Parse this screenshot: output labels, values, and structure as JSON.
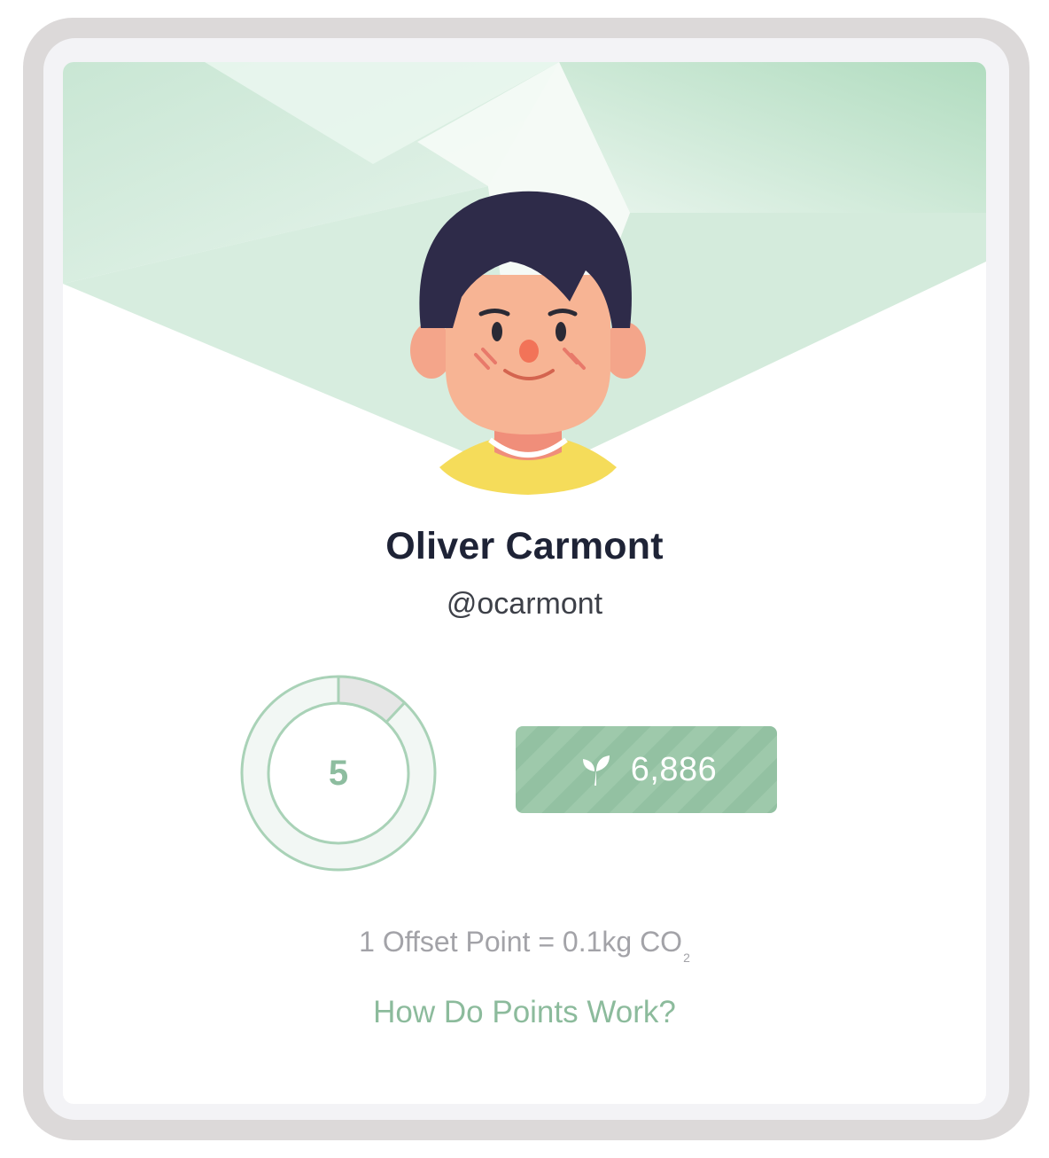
{
  "profile": {
    "name": "Oliver Carmont",
    "handle": "@ocarmont"
  },
  "level": {
    "value": "5",
    "progress_fraction": 0.12
  },
  "points": {
    "icon": "sprout-icon",
    "value": "6,886"
  },
  "conversion": {
    "text": "1 Offset Point = 0.1kg CO",
    "subscript": "2"
  },
  "help_link": {
    "label": "How Do Points Work?"
  },
  "colors": {
    "accent_green": "#8cbb9c",
    "badge_green": "#9ec9ab",
    "ring_green": "#a9d2b7",
    "name_text": "#1e2336"
  }
}
